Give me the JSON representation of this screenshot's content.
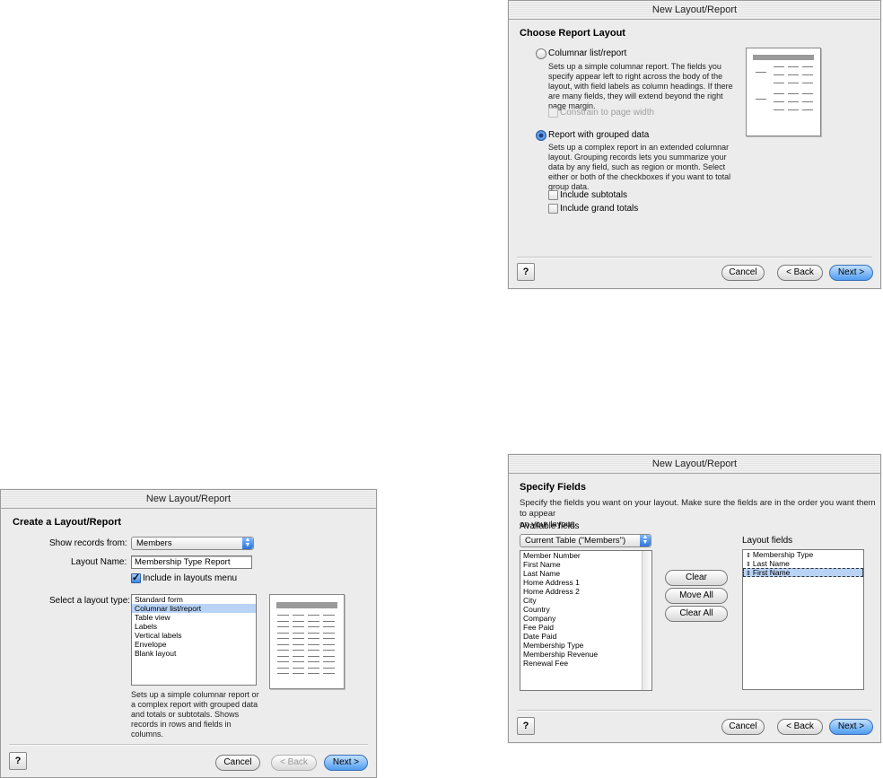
{
  "w1": {
    "title": "New Layout/Report",
    "heading": "Create a Layout/Report",
    "show_records_label": "Show records from:",
    "show_records_value": "Members",
    "layout_name_label": "Layout Name:",
    "layout_name_value": "Membership Type Report",
    "include_menu_label": "Include in layouts menu",
    "layout_type_label": "Select a layout type:",
    "layout_types": [
      "Standard form",
      "Columnar list/report",
      "Table view",
      "Labels",
      "Vertical labels",
      "Envelope",
      "Blank layout"
    ],
    "selected_type_index": 1,
    "desc1": "Sets up a simple columnar report or",
    "desc2": "a complex report with grouped data",
    "desc3": "and totals or subtotals. Shows",
    "desc4": "records in rows and fields in",
    "desc5": "columns.",
    "help": "?",
    "cancel": "Cancel",
    "back": "< Back",
    "next": "Next >"
  },
  "w2": {
    "title": "New Layout/Report",
    "heading": "Choose Report Layout",
    "opt1_label": "Columnar list/report",
    "opt1_d1": "Sets up a simple columnar report. The fields you",
    "opt1_d2": "specify appear left to right across the body of the",
    "opt1_d3": "layout, with field labels as column headings. If there",
    "opt1_d4": "are many fields, they will extend beyond the right",
    "opt1_d5": "page margin.",
    "constrain_label": "Constrain to page width",
    "opt2_label": "Report with grouped data",
    "opt2_d1": "Sets up a complex report in an extended columnar",
    "opt2_d2": "layout. Grouping records lets you summarize your",
    "opt2_d3": "data by any field, such as region or month. Select",
    "opt2_d4": "either or both of the checkboxes if you want to total",
    "opt2_d5": "group data.",
    "subtotals_label": "Include subtotals",
    "grand_label": "Include grand totals",
    "help": "?",
    "cancel": "Cancel",
    "back": "< Back",
    "next": "Next >"
  },
  "w3": {
    "title": "New Layout/Report",
    "heading": "Specify Fields",
    "intro1": "Specify the fields you want on your layout. Make sure the fields are in the order you want them to appear",
    "intro2": "on your layout.",
    "available_label": "Available fields",
    "table_popup": "Current Table (\"Members\")",
    "available_fields": [
      "Member Number",
      "First Name",
      "Last Name",
      "Home Address 1",
      "Home Address 2",
      "City",
      "Country",
      "Company",
      "Fee Paid",
      "Date Paid",
      "Membership Type",
      "Membership Revenue",
      "Renewal Fee"
    ],
    "clear": "Clear",
    "move_all": "Move All",
    "clear_all": "Clear All",
    "layout_fields_label": "Layout fields",
    "layout_fields": [
      "Membership Type",
      "Last Name",
      "First Name"
    ],
    "selected_layout_index": 2,
    "help": "?",
    "cancel": "Cancel",
    "back": "< Back",
    "next": "Next >"
  }
}
